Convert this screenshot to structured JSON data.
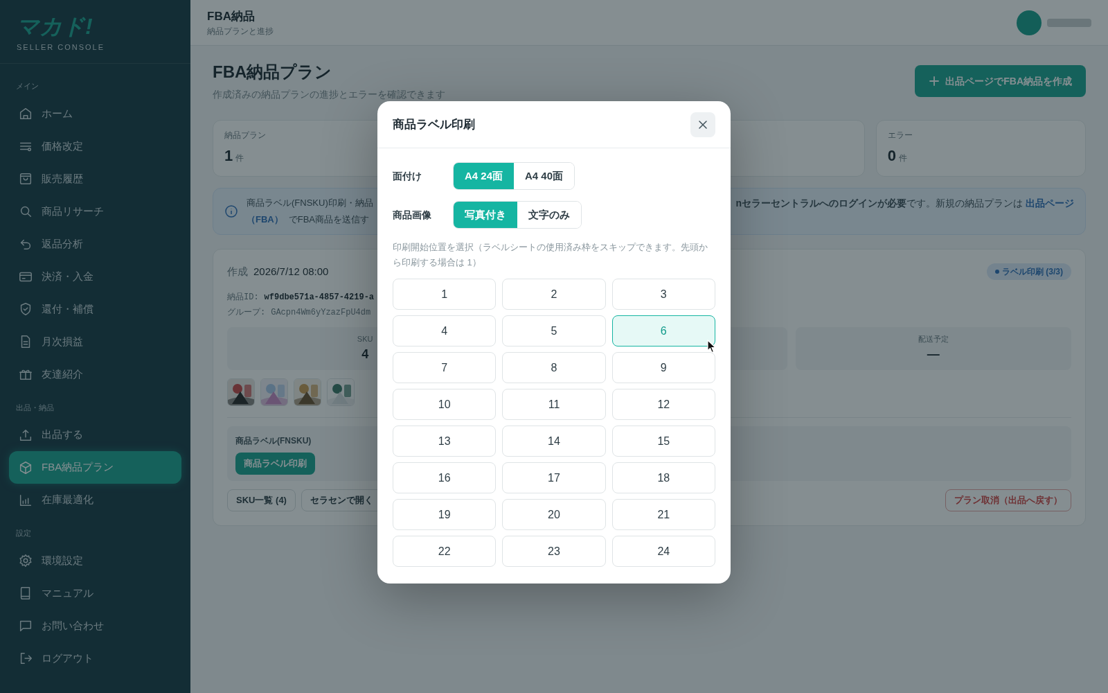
{
  "sidebar": {
    "logo": "マカド!",
    "subtitle": "SELLER CONSOLE",
    "sections": [
      {
        "title": "メイン",
        "items": [
          {
            "label": "ホーム",
            "selected": false
          },
          {
            "label": "価格改定",
            "selected": false
          },
          {
            "label": "販売履歴",
            "selected": false
          },
          {
            "label": "商品リサーチ",
            "selected": false
          },
          {
            "label": "返品分析",
            "selected": false
          },
          {
            "label": "決済・入金",
            "selected": false
          },
          {
            "label": "還付・補償",
            "selected": false
          },
          {
            "label": "月次損益",
            "selected": false
          },
          {
            "label": "友達紹介",
            "selected": false
          }
        ]
      },
      {
        "title": "出品・納品",
        "items": [
          {
            "label": "出品する",
            "selected": false
          },
          {
            "label": "FBA納品プラン",
            "selected": true
          },
          {
            "label": "在庫最適化",
            "selected": false
          }
        ]
      },
      {
        "title": "設定",
        "items": [
          {
            "label": "環境設定",
            "selected": false
          },
          {
            "label": "マニュアル",
            "selected": false
          },
          {
            "label": "お問い合わせ",
            "selected": false
          },
          {
            "label": "ログアウト",
            "selected": false
          }
        ]
      }
    ]
  },
  "header": {
    "title": "FBA納品",
    "subtitle": "納品プランと進捗"
  },
  "page": {
    "title": "FBA納品プラン",
    "subtitle": "作成済みの納品プランの進捗とエラーを確認できます",
    "create_button": "出品ページでFBA納品を作成"
  },
  "stats": [
    {
      "label": "納品プラン",
      "value": "1",
      "unit": "件"
    },
    {
      "label": "エラー",
      "value": "0",
      "unit": "件"
    }
  ],
  "info_banner": {
    "left_lines": [
      [
        {
          "kind": "text",
          "text": "商品ラベル(FNSKU)印刷・納品"
        }
      ],
      [
        {
          "kind": "link",
          "text": "（FBA）"
        },
        {
          "kind": "text",
          "text": "でFBA商品を送信す"
        }
      ]
    ],
    "right_line": [
      {
        "kind": "text",
        "text": "**nセラーセントラルへのログインが必要**です。新規の納品プランは"
      },
      {
        "kind": "link",
        "text": "出品ページ"
      }
    ]
  },
  "plan": {
    "created_label": "作成",
    "created": "2026/7/12 08:00",
    "id_label": "納品ID:",
    "id": "wf9dbe571a-4857-4219-a",
    "group_label": "グループ:",
    "group": "GAcpn4Wm6yYzazFpU4dm",
    "status": "ラベル印刷 (3/3)",
    "metrics": [
      {
        "label": "SKU",
        "value": "4"
      },
      {
        "label": "配送予定",
        "value": "—"
      }
    ],
    "label_section": {
      "title": "商品ラベル(FNSKU)",
      "button": "商品ラベル印刷"
    },
    "actions": [
      {
        "label": "SKU一覧 (4)",
        "kind": "default"
      },
      {
        "label": "セラセンで開く",
        "kind": "default"
      },
      {
        "label": "プラン取消（出品へ戻す）",
        "kind": "danger"
      }
    ]
  },
  "modal": {
    "title": "商品ラベル印刷",
    "options": [
      {
        "label": "面付け",
        "choices": [
          {
            "label": "A4 24面",
            "selected": true
          },
          {
            "label": "A4 40面",
            "selected": false
          }
        ]
      },
      {
        "label": "商品画像",
        "choices": [
          {
            "label": "写真付き",
            "selected": true
          },
          {
            "label": "文字のみ",
            "selected": false
          }
        ]
      }
    ],
    "hint": "印刷開始位置を選択（ラベルシートの使用済み枠をスキップできます。先頭から印刷する場合は 1）",
    "positions": [
      {
        "label": "1",
        "selected": false
      },
      {
        "label": "2",
        "selected": false
      },
      {
        "label": "3",
        "selected": false
      },
      {
        "label": "4",
        "selected": false
      },
      {
        "label": "5",
        "selected": false
      },
      {
        "label": "6",
        "selected": true
      },
      {
        "label": "7",
        "selected": false
      },
      {
        "label": "8",
        "selected": false
      },
      {
        "label": "9",
        "selected": false
      },
      {
        "label": "10",
        "selected": false
      },
      {
        "label": "11",
        "selected": false
      },
      {
        "label": "12",
        "selected": false
      },
      {
        "label": "13",
        "selected": false
      },
      {
        "label": "14",
        "selected": false
      },
      {
        "label": "15",
        "selected": false
      },
      {
        "label": "16",
        "selected": false
      },
      {
        "label": "17",
        "selected": false
      },
      {
        "label": "18",
        "selected": false
      },
      {
        "label": "19",
        "selected": false
      },
      {
        "label": "20",
        "selected": false
      },
      {
        "label": "21",
        "selected": false
      },
      {
        "label": "22",
        "selected": false
      },
      {
        "label": "23",
        "selected": false
      },
      {
        "label": "24",
        "selected": false
      }
    ]
  }
}
